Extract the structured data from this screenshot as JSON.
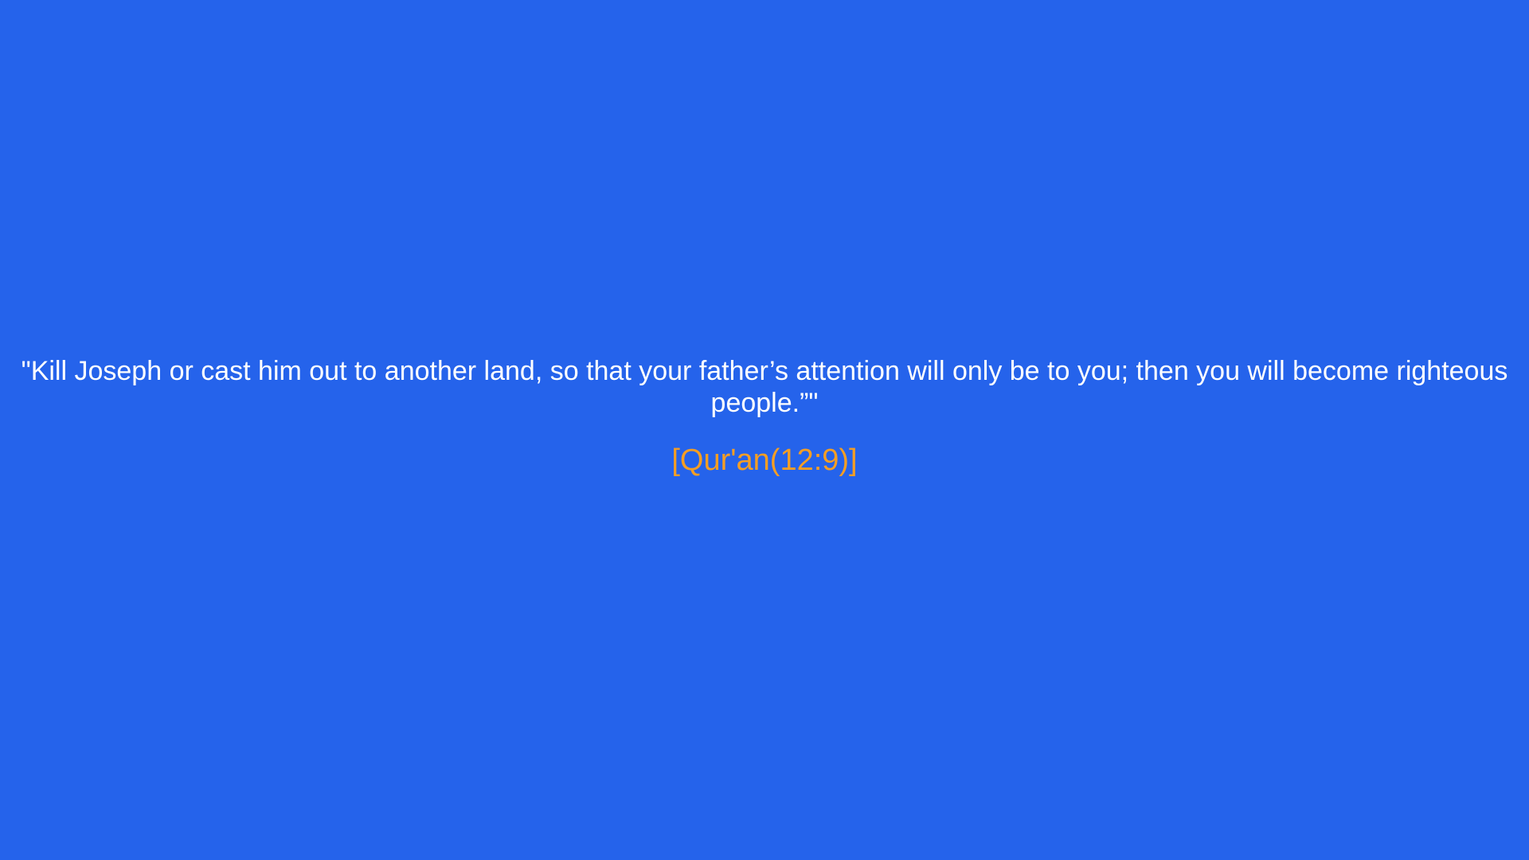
{
  "quote": {
    "text": "\"Kill Joseph or cast him out to another land, so that your father’s attention will only be to you; then you will become righteous people.”\"",
    "citation": "[Qur'an(12:9)]"
  },
  "colors": {
    "background": "#2563eb",
    "quote_text": "#ffffff",
    "citation_text": "#f59e24"
  }
}
